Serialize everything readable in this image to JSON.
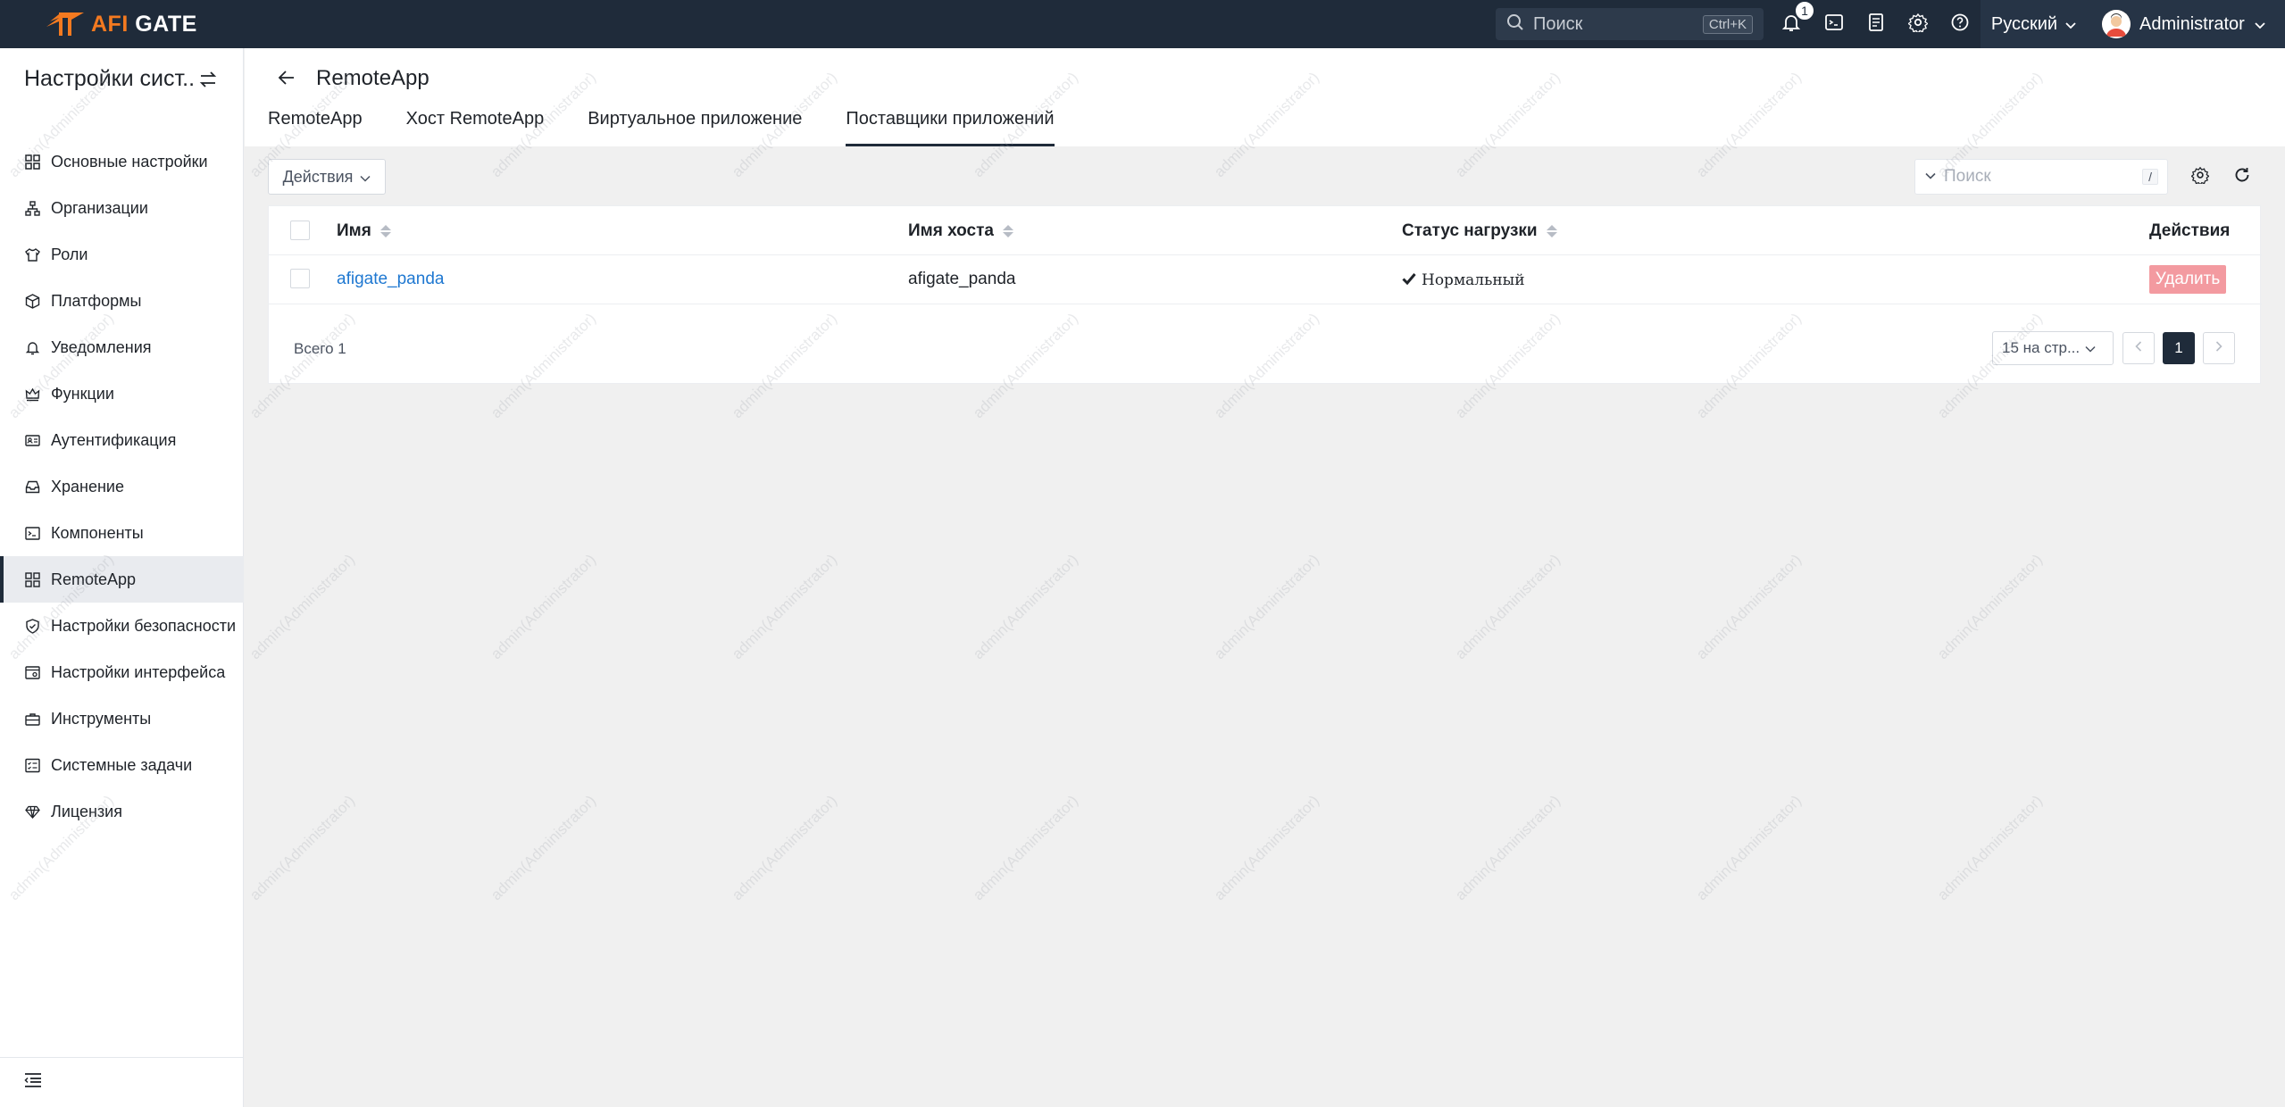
{
  "app": {
    "brand_prefix": "AFI",
    "brand_suffix": "GATE"
  },
  "topbar": {
    "search_placeholder": "Поиск",
    "search_shortcut": "Ctrl+K",
    "notification_count": "1",
    "language": "Русский",
    "user_name": "Administrator"
  },
  "sidebar": {
    "title": "Настройки сист...",
    "items": [
      {
        "label": "Основные настройки",
        "icon": "grid-icon"
      },
      {
        "label": "Организации",
        "icon": "org-tree-icon"
      },
      {
        "label": "Роли",
        "icon": "shirt-icon"
      },
      {
        "label": "Платформы",
        "icon": "cube-icon"
      },
      {
        "label": "Уведомления",
        "icon": "bell-icon"
      },
      {
        "label": "Функции",
        "icon": "crown-icon"
      },
      {
        "label": "Аутентификация",
        "icon": "id-card-icon"
      },
      {
        "label": "Хранение",
        "icon": "inbox-icon"
      },
      {
        "label": "Компоненты",
        "icon": "terminal-icon"
      },
      {
        "label": "RemoteApp",
        "icon": "apps-icon"
      },
      {
        "label": "Настройки безопасности",
        "icon": "shield-icon"
      },
      {
        "label": "Настройки интерфейса",
        "icon": "window-gear-icon"
      },
      {
        "label": "Инструменты",
        "icon": "toolbox-icon"
      },
      {
        "label": "Системные задачи",
        "icon": "task-list-icon"
      },
      {
        "label": "Лицензия",
        "icon": "diamond-icon"
      }
    ],
    "active_index": 9
  },
  "page": {
    "title": "RemoteApp",
    "tabs": [
      "RemoteApp",
      "Хост RemoteApp",
      "Виртуальное приложение",
      "Поставщики приложений"
    ],
    "active_tab": 3
  },
  "toolbar": {
    "actions_label": "Действия",
    "search_placeholder": "Поиск",
    "search_shortcut": "/"
  },
  "table": {
    "columns": [
      "Имя",
      "Имя хоста",
      "Статус нагрузки",
      "Действия"
    ],
    "rows": [
      {
        "name": "afigate_panda",
        "host": "afigate_panda",
        "status": "Нормальный",
        "action": "Удалить"
      }
    ],
    "total": "Всего 1",
    "page_size": "15 на стр...",
    "current_page": "1"
  },
  "watermark": "admin(Administrator)",
  "colors": {
    "topbar": "#1f2b3a",
    "accent": "#f47a20",
    "link": "#1f78d1",
    "danger": "#f39aa0"
  }
}
